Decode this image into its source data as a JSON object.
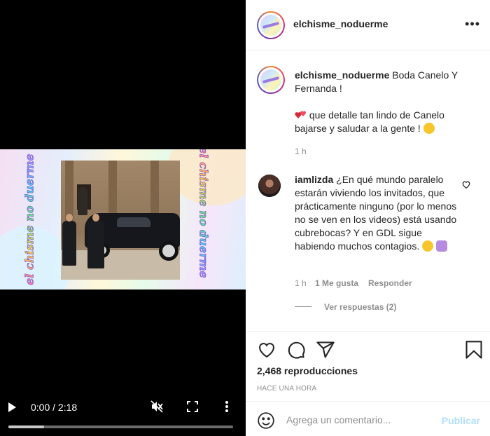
{
  "video": {
    "watermark_text": "el chisme no duerme",
    "current_time": "0:00",
    "duration": "2:18",
    "time_display": "0:00 / 2:18",
    "progress_fraction": 0.16,
    "icons": [
      "play-icon",
      "mute-icon",
      "fullscreen-icon",
      "more-vertical-icon"
    ]
  },
  "header": {
    "username": "elchisme_noduerme",
    "more_icon": "ellipsis-icon"
  },
  "caption": {
    "username": "elchisme_noduerme",
    "text_line1": "Boda Canelo Y",
    "text_line2": "Fernanda !",
    "body_prefix": "que detalle tan lindo de Canelo",
    "body_line2": "bajarse y saludar a la gente !",
    "time": "1 h"
  },
  "comment": {
    "username": "iamlizda",
    "text": "¿En qué mundo paralelo estarán viviendo los invitados, que prácticamente ninguno (por lo menos no se ven en los videos) está usando cubrebocas? Y en GDL sigue habiendo muchos contagios.",
    "time": "1 h",
    "likes": "1 Me gusta",
    "reply": "Responder",
    "view_replies": "Ver respuestas (2)"
  },
  "actions": {
    "views": "2,468 reproducciones",
    "posted": "HACE UNA HORA",
    "icons": [
      "heart-icon",
      "comment-icon",
      "share-icon",
      "bookmark-icon"
    ]
  },
  "composer": {
    "placeholder": "Agrega un comentario...",
    "publish_label": "Publicar"
  },
  "colors": {
    "accent_disabled": "#b2dffc",
    "muted_text": "#8e8e8e",
    "primary_text": "#262626",
    "video_bg": "#000000"
  }
}
